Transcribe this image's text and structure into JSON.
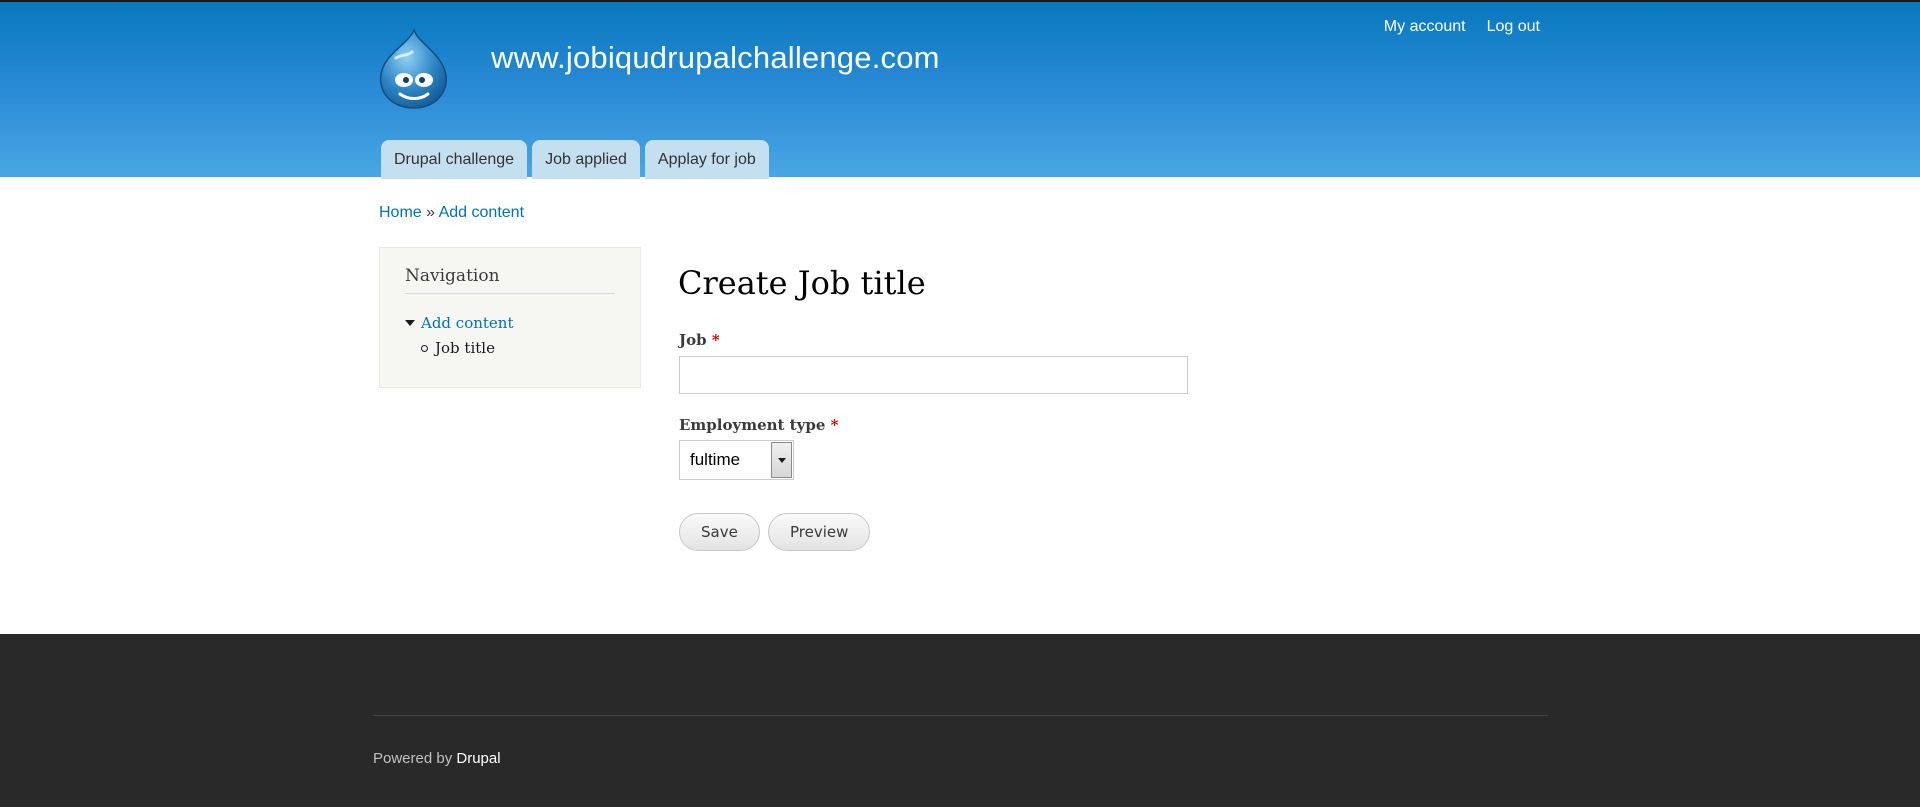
{
  "header": {
    "site_name": "www.jobiqudrupalchallenge.com",
    "secondary_menu": [
      "My account",
      "Log out"
    ],
    "main_menu": [
      "Drupal challenge",
      "Job applied",
      "Applay for job"
    ]
  },
  "breadcrumb": {
    "home": "Home",
    "separator": "»",
    "current": "Add content"
  },
  "sidebar": {
    "title": "Navigation",
    "items": [
      {
        "label": "Add content",
        "expanded": true
      },
      {
        "label": "Job title",
        "active": true
      }
    ]
  },
  "content": {
    "title": "Create Job title",
    "fields": {
      "job_label": "Job",
      "job_value": "",
      "required_marker": "*",
      "employment_label": "Employment type",
      "employment_value": "fultime"
    },
    "buttons": {
      "save": "Save",
      "preview": "Preview"
    }
  },
  "footer": {
    "powered_by": "Powered by",
    "link": "Drupal"
  },
  "colors": {
    "header_gradient_top": "#0779bf",
    "header_gradient_bottom": "#48a7e3",
    "link": "#0071b3",
    "footer_bg": "#292929",
    "required": "#cc0000"
  }
}
